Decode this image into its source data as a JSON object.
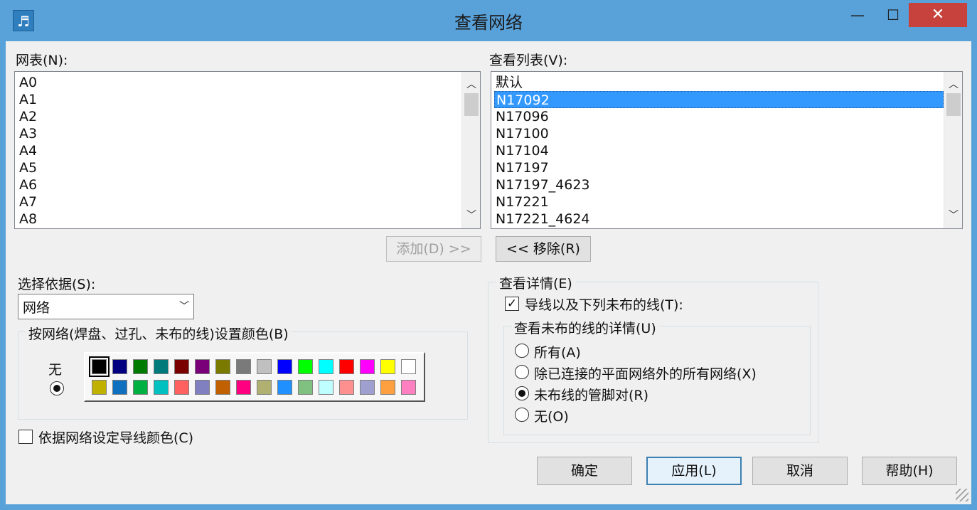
{
  "window": {
    "title": "查看网络",
    "icon": "music-note-icon"
  },
  "controls": {
    "minimize": "—",
    "maximize": "☐",
    "close": "✕"
  },
  "nets": {
    "label": "网表(N):",
    "items": [
      "A0",
      "A1",
      "A2",
      "A3",
      "A4",
      "A5",
      "A6",
      "A7",
      "A8"
    ]
  },
  "view_list": {
    "label": "查看列表(V):",
    "items": [
      "默认",
      "N17092",
      "N17096",
      "N17100",
      "N17104",
      "N17197",
      "N17197_4623",
      "N17221",
      "N17221_4624"
    ],
    "selected_index": 1
  },
  "buttons": {
    "add": "添加(D) >>",
    "remove": "<< 移除(R)",
    "ok": "确定",
    "apply": "应用(L)",
    "cancel": "取消",
    "help": "帮助(H)"
  },
  "select_by": {
    "label": "选择依据(S):",
    "value": "网络"
  },
  "color_group": {
    "title": "按网络(焊盘、过孔、未布的线)设置颜色(B)",
    "none_label": "无",
    "row1": [
      "#000000",
      "#000080",
      "#007a00",
      "#007a7a",
      "#7a0000",
      "#7a007a",
      "#7a7a00",
      "#7a7a7a",
      "#c0c0c0",
      "#0000ff",
      "#00ff00",
      "#00ffff",
      "#ff0000",
      "#ff00ff",
      "#ffff00",
      "#ffffff"
    ],
    "row2": [
      "#c0b000",
      "#1070c0",
      "#00b040",
      "#00c0c0",
      "#ff6060",
      "#8080c0",
      "#c06000",
      "#ff0080",
      "#b0b070",
      "#2090ff",
      "#80c080",
      "#c0ffff",
      "#ff9090",
      "#a0a0d0",
      "#ffa040",
      "#ff80c0"
    ]
  },
  "trace_color": {
    "label": "依据网络设定导线颜色(C)",
    "checked": false
  },
  "details": {
    "title": "查看详情(E)",
    "traces_label": "导线以及下列未布的线(T):",
    "traces_checked": true,
    "unrouted_title": "查看未布的线的详情(U)",
    "options": [
      "所有(A)",
      "除已连接的平面网络外的所有网络(X)",
      "未布线的管脚对(R)",
      "无(O)"
    ],
    "selected_option": 2
  }
}
